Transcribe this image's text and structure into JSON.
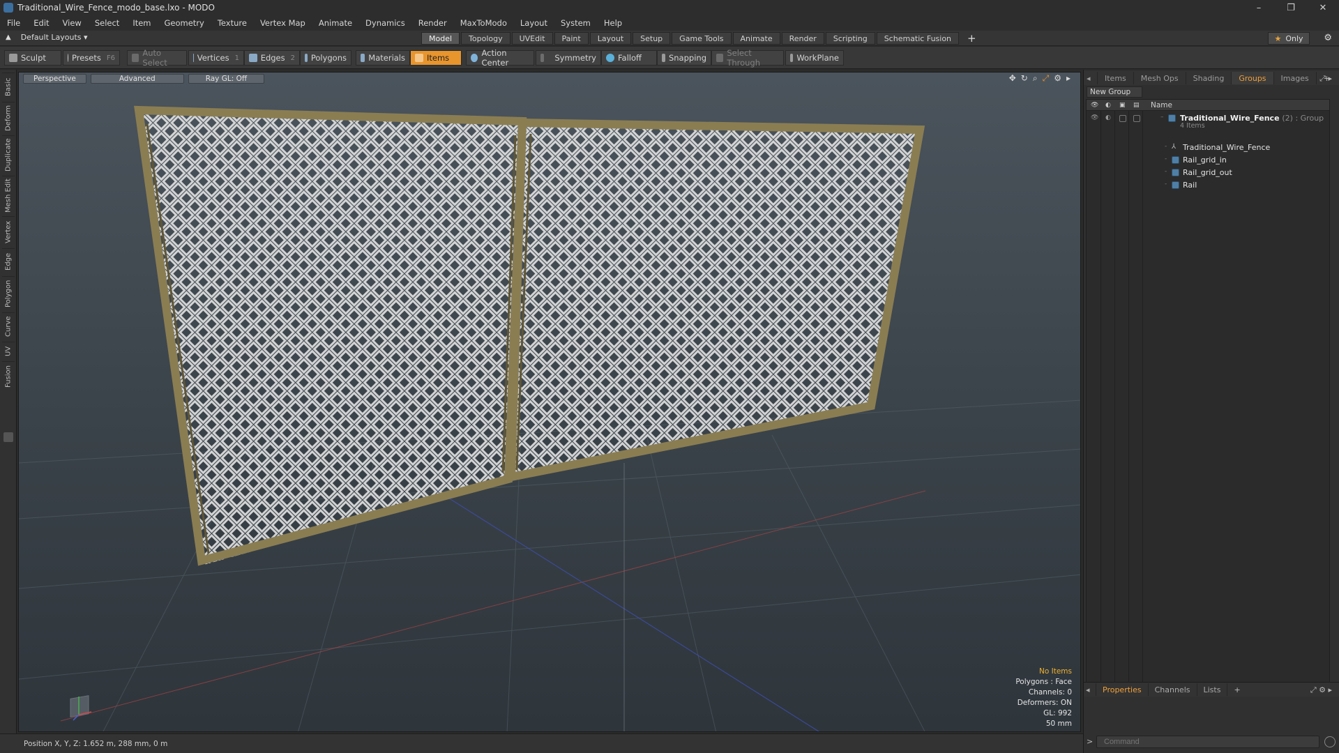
{
  "window": {
    "title": "Traditional_Wire_Fence_modo_base.lxo - MODO",
    "controls": [
      "–",
      "❐",
      "✕"
    ]
  },
  "menu": [
    "File",
    "Edit",
    "View",
    "Select",
    "Item",
    "Geometry",
    "Texture",
    "Vertex Map",
    "Animate",
    "Dynamics",
    "Render",
    "MaxToModo",
    "Layout",
    "System",
    "Help"
  ],
  "layout_bar": {
    "layout_selector": "Default Layouts ▾",
    "tabs": [
      "Model",
      "Topology",
      "UVEdit",
      "Paint",
      "Layout",
      "Setup",
      "Game Tools",
      "Animate",
      "Render",
      "Scripting",
      "Schematic Fusion"
    ],
    "active_tab": "Model",
    "only_label": "Only"
  },
  "toolbar": {
    "sculpt": "Sculpt",
    "presets": "Presets",
    "presets_key": "F6",
    "auto_select": "Auto Select",
    "vertices": "Vertices",
    "vertices_count": "1",
    "edges": "Edges",
    "edges_count": "2",
    "polygons": "Polygons",
    "materials": "Materials",
    "items": "Items",
    "action_center": "Action Center",
    "symmetry": "Symmetry",
    "falloff": "Falloff",
    "snapping": "Snapping",
    "select_through": "Select Through",
    "workplane": "WorkPlane"
  },
  "left_tabs": [
    "Basic",
    "Deform",
    "Duplicate",
    "Mesh Edit",
    "Vertex",
    "Edge",
    "Polygon",
    "Curve",
    "UV",
    "Fusion"
  ],
  "viewport": {
    "view_mode": "Perspective",
    "shading": "Advanced",
    "raygl": "Ray GL: Off",
    "info": {
      "selection": "No Items",
      "polygons": "Polygons : Face",
      "channels": "Channels: 0",
      "deformers": "Deformers: ON",
      "gl": "GL: 992",
      "grid": "50 mm"
    }
  },
  "status_bar": {
    "position": "Position X, Y, Z:  1.652 m, 288 mm, 0 m"
  },
  "right_panel": {
    "tabs": [
      "Items",
      "Mesh Ops",
      "Shading",
      "Groups",
      "Images"
    ],
    "active_tab": "Groups",
    "new_group": "New Group",
    "column_name": "Name",
    "group": {
      "name": "Traditional_Wire_Fence",
      "meta": "(2) : Group",
      "count": "4 Items"
    },
    "items": [
      "Traditional_Wire_Fence",
      "Rail_grid_in",
      "Rail_grid_out",
      "Rail"
    ],
    "bottom_tabs": [
      "Properties",
      "Channels",
      "Lists"
    ],
    "bottom_active": "Properties",
    "command_placeholder": "Command"
  },
  "colors": {
    "accent": "#e8952e",
    "fence_frame": "#8a7d52",
    "mesh": "#d8d8d8"
  }
}
